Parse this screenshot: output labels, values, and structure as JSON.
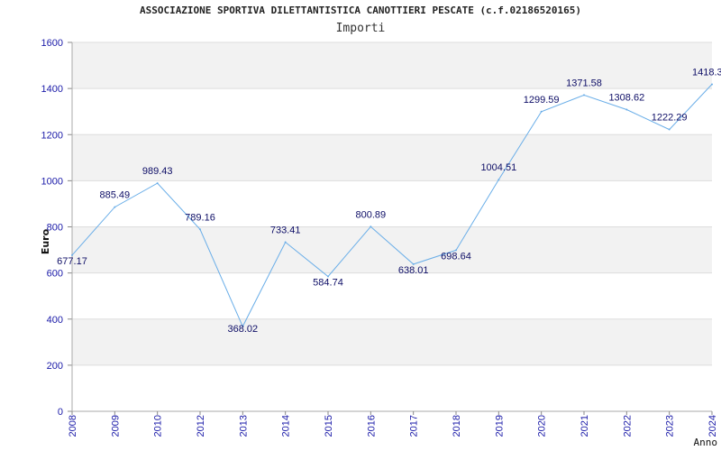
{
  "chart_data": {
    "type": "line",
    "title": "ASSOCIAZIONE SPORTIVA DILETTANTISTICA CANOTTIERI PESCATE (c.f.02186520165)",
    "subtitle": "Importi",
    "xlabel": "Anno",
    "ylabel": "Euro",
    "ylim": [
      0,
      1600
    ],
    "yticks": [
      0,
      200,
      400,
      600,
      800,
      1000,
      1200,
      1400,
      1600
    ],
    "categories": [
      "2008",
      "2009",
      "2010",
      "2012",
      "2013",
      "2014",
      "2015",
      "2016",
      "2017",
      "2018",
      "2019",
      "2020",
      "2021",
      "2022",
      "2023",
      "2024"
    ],
    "values": [
      677.17,
      885.49,
      989.43,
      789.16,
      368.02,
      733.41,
      584.74,
      800.89,
      638.01,
      698.64,
      1004.51,
      1299.59,
      1371.58,
      1308.62,
      1222.29,
      1418.3
    ],
    "value_labels": [
      "677.17",
      "885.49",
      "989.43",
      "789.16",
      "368.02",
      "733.41",
      "584.74",
      "800.89",
      "638.01",
      "698.64",
      "1004.51",
      "1299.59",
      "1371.58",
      "1308.62",
      "1222.29",
      "1418.3"
    ],
    "grid": true,
    "colors": {
      "line": "#6aaee8",
      "band": "#f2f2f2",
      "grid": "#dddddd",
      "tick_text": "#1a1aa8",
      "label_text": "#0d0d66"
    }
  }
}
